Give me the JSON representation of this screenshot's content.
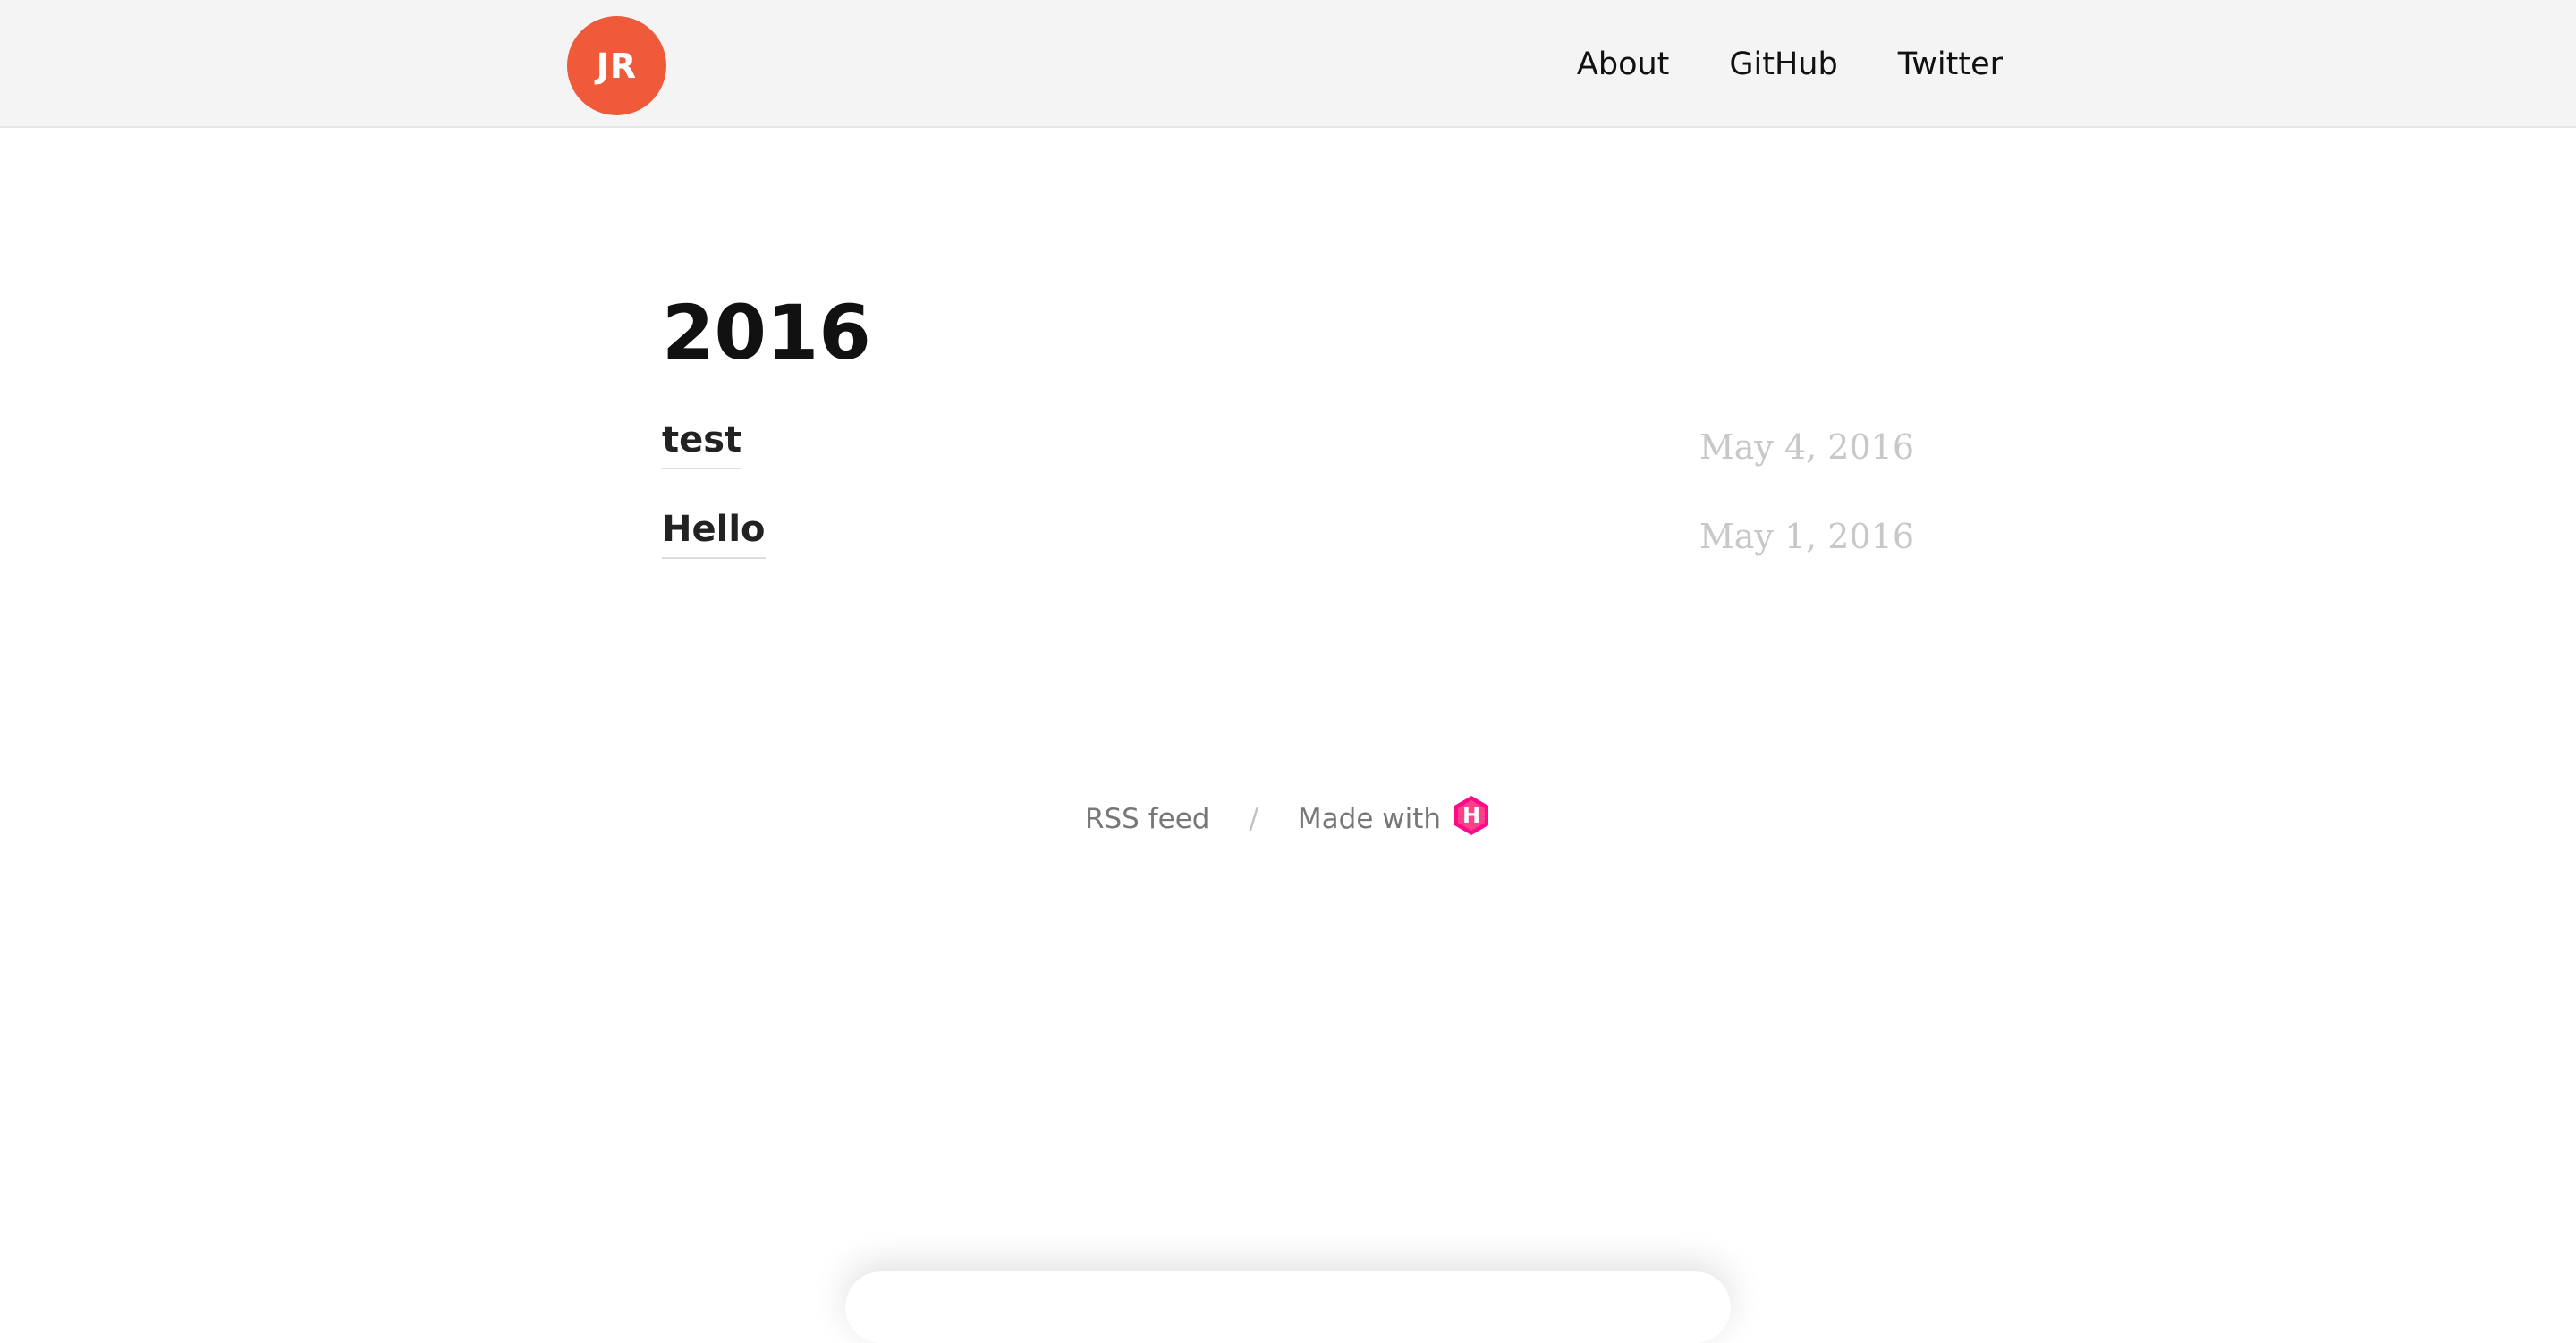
{
  "header": {
    "avatar_initials": "JR",
    "avatar_color": "#ee5a3a",
    "nav": [
      {
        "label": "About"
      },
      {
        "label": "GitHub"
      },
      {
        "label": "Twitter"
      }
    ]
  },
  "main": {
    "year": "2016",
    "posts": [
      {
        "title": "test",
        "date": "May 4, 2016"
      },
      {
        "title": "Hello",
        "date": "May 1, 2016"
      }
    ]
  },
  "footer": {
    "rss_label": "RSS feed",
    "separator": "/",
    "made_with_label": "Made with",
    "hugo_icon_letter": "H",
    "hugo_icon_color": "#ff0a8b"
  }
}
